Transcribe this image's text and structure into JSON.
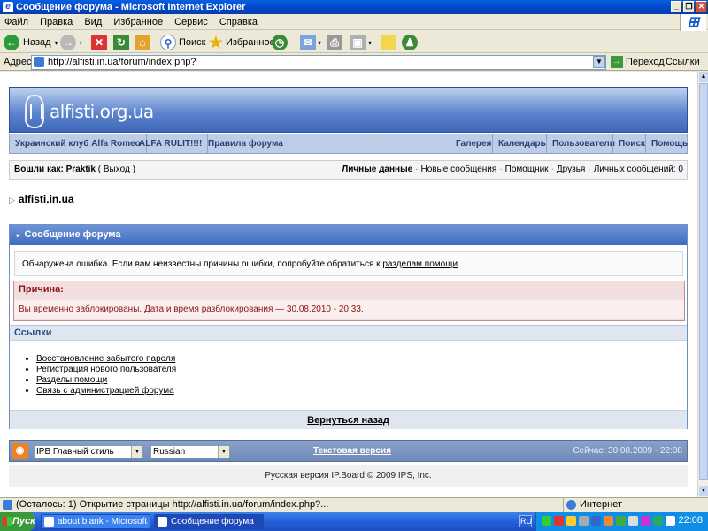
{
  "window": {
    "title": "Сообщение форума - Microsoft Internet Explorer",
    "minimize": "_",
    "maximize": "❐",
    "close": "✕"
  },
  "menu": [
    "Файл",
    "Правка",
    "Вид",
    "Избранное",
    "Сервис",
    "Справка"
  ],
  "toolbar": {
    "back": "Назад",
    "search": "Поиск",
    "favorites": "Избранное"
  },
  "address": {
    "label": "Адрес:",
    "url": "http://alfisti.in.ua/forum/index.php?",
    "go": "Переход",
    "links": "Ссылки"
  },
  "header": {
    "logo_text": "alfisti.org.ua"
  },
  "navbar": {
    "left": [
      "Украинский клуб Alfa Romeo",
      "ALFA RULIT!!!!",
      "Правила форума"
    ],
    "right": [
      "Галерея",
      "Календарь",
      "Пользователи",
      "Поиск",
      "Помощь"
    ]
  },
  "userbar": {
    "logged_in_as": "Вошли как:",
    "username": "Praktik",
    "logout": "Выход",
    "links": [
      "Личные данные",
      "Новые сообщения",
      "Помощник",
      "Друзья",
      "Личных сообщений: 0"
    ]
  },
  "breadcrumb": "alfisti.in.ua",
  "message": {
    "title": "Сообщение форума",
    "error_text": "Обнаружена ошибка. Если вам неизвестны причины ошибки, попробуйте обратиться к",
    "error_link": "разделам помощи",
    "reason_title": "Причина:",
    "reason_text": "Вы временно заблокированы. Дата и время разблокирования — 30.08.2010 - 20:33.",
    "links_title": "Ссылки",
    "links": [
      "Восстановление забытого пароля",
      "Регистрация нового пользователя",
      "Разделы помощи",
      "Связь с администрацией форума"
    ],
    "back": "Вернуться назад"
  },
  "footer": {
    "skin": "IPB Главный стиль",
    "language": "Russian",
    "text_version": "Текстовая версия",
    "server_time": "Сейчас: 30.08.2009 - 22:08",
    "copyright": "Русская версия IP.Board © 2009  IPS, Inc."
  },
  "statusbar": {
    "text": "(Осталось: 1) Открытие страницы http://alfisti.in.ua/forum/index.php?...",
    "zone": "Интернет"
  },
  "taskbar": {
    "start": "Пуск",
    "tasks": [
      "about:blank - Microsoft I...",
      "Сообщение форума -..."
    ],
    "lang": "RU",
    "clock": "22:08"
  }
}
